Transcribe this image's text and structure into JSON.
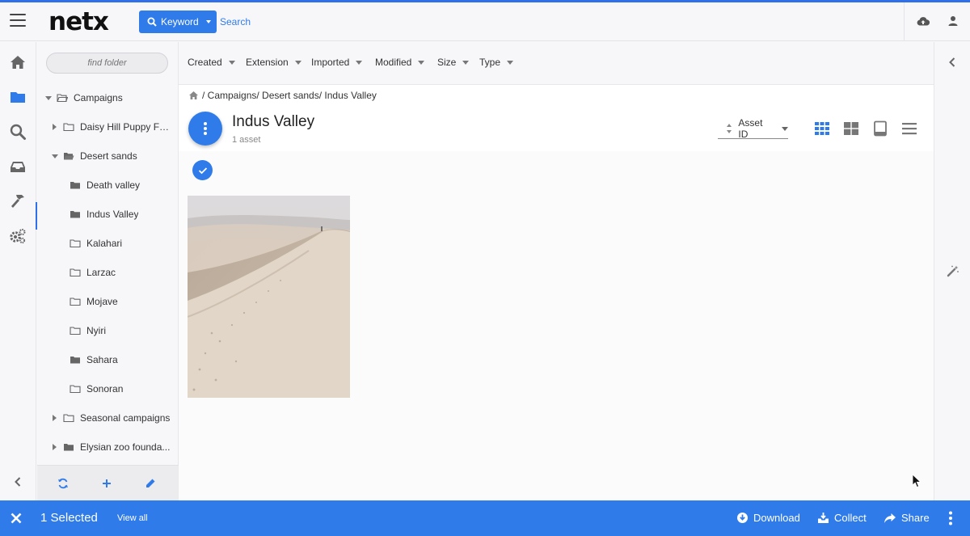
{
  "header": {
    "logo": "netx",
    "search_mode_label": "Keyword",
    "search_placeholder": "Search"
  },
  "folders": {
    "find_placeholder": "find folder",
    "tree": [
      {
        "label": "Campaigns",
        "level": 0,
        "expanded": true
      },
      {
        "label": "Daisy Hill Puppy Fa...",
        "level": 1,
        "expanded": false
      },
      {
        "label": "Desert sands",
        "level": 1,
        "expanded": true
      },
      {
        "label": "Death valley",
        "level": 2
      },
      {
        "label": "Indus Valley",
        "level": 2,
        "selected": true
      },
      {
        "label": "Kalahari",
        "level": 2
      },
      {
        "label": "Larzac",
        "level": 2
      },
      {
        "label": "Mojave",
        "level": 2
      },
      {
        "label": "Nyiri",
        "level": 2
      },
      {
        "label": "Sahara",
        "level": 2
      },
      {
        "label": "Sonoran",
        "level": 2
      },
      {
        "label": "Seasonal campaigns",
        "level": 1,
        "expanded": false
      },
      {
        "label": "Elysian zoo founda...",
        "level": 1,
        "expanded": false
      }
    ]
  },
  "filters": [
    "Created",
    "Extension",
    "Imported",
    "Modified",
    "Size",
    "Type"
  ],
  "breadcrumb": "/ Campaigns/ Desert sands/ Indus Valley",
  "content": {
    "title": "Indus Valley",
    "asset_count": "1 asset",
    "sort_label": "Asset ID"
  },
  "selection_bar": {
    "selected": "1 Selected",
    "view_all": "View all",
    "download": "Download",
    "collect": "Collect",
    "share": "Share"
  },
  "colors": {
    "accent": "#2f7bea",
    "accent_dark": "#2f6fea"
  }
}
